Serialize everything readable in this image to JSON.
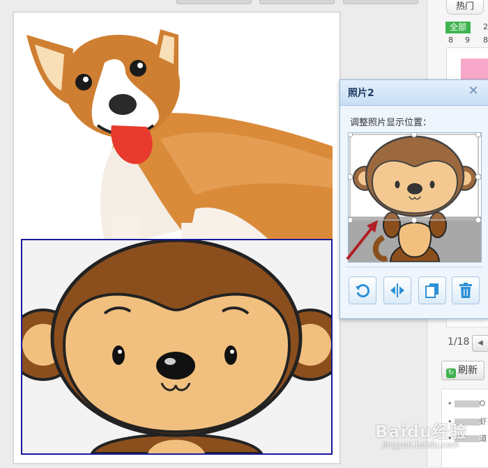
{
  "top_tabs": {
    "hot": "热门",
    "all": "全部"
  },
  "digits": [
    "2",
    "8",
    "9",
    "8"
  ],
  "pager": {
    "text": "1/18"
  },
  "refresh_label": "刷新",
  "list_rows": [
    "O",
    "虾",
    "道"
  ],
  "dialog": {
    "title": "照片2",
    "close_icon": "close-icon",
    "instruction": "调整照片显示位置：",
    "buttons": [
      "rotate-icon",
      "flip-horizontal-icon",
      "copy-icon",
      "trash-icon"
    ]
  },
  "watermark": {
    "brand": "Baidu经验",
    "url": "jingyan.baidu.com"
  },
  "colors": {
    "accent_green": "#3fb34f",
    "selection_border": "#15199a",
    "dialog_bg": "#eef5fc",
    "arrow_red": "#b01f24"
  }
}
